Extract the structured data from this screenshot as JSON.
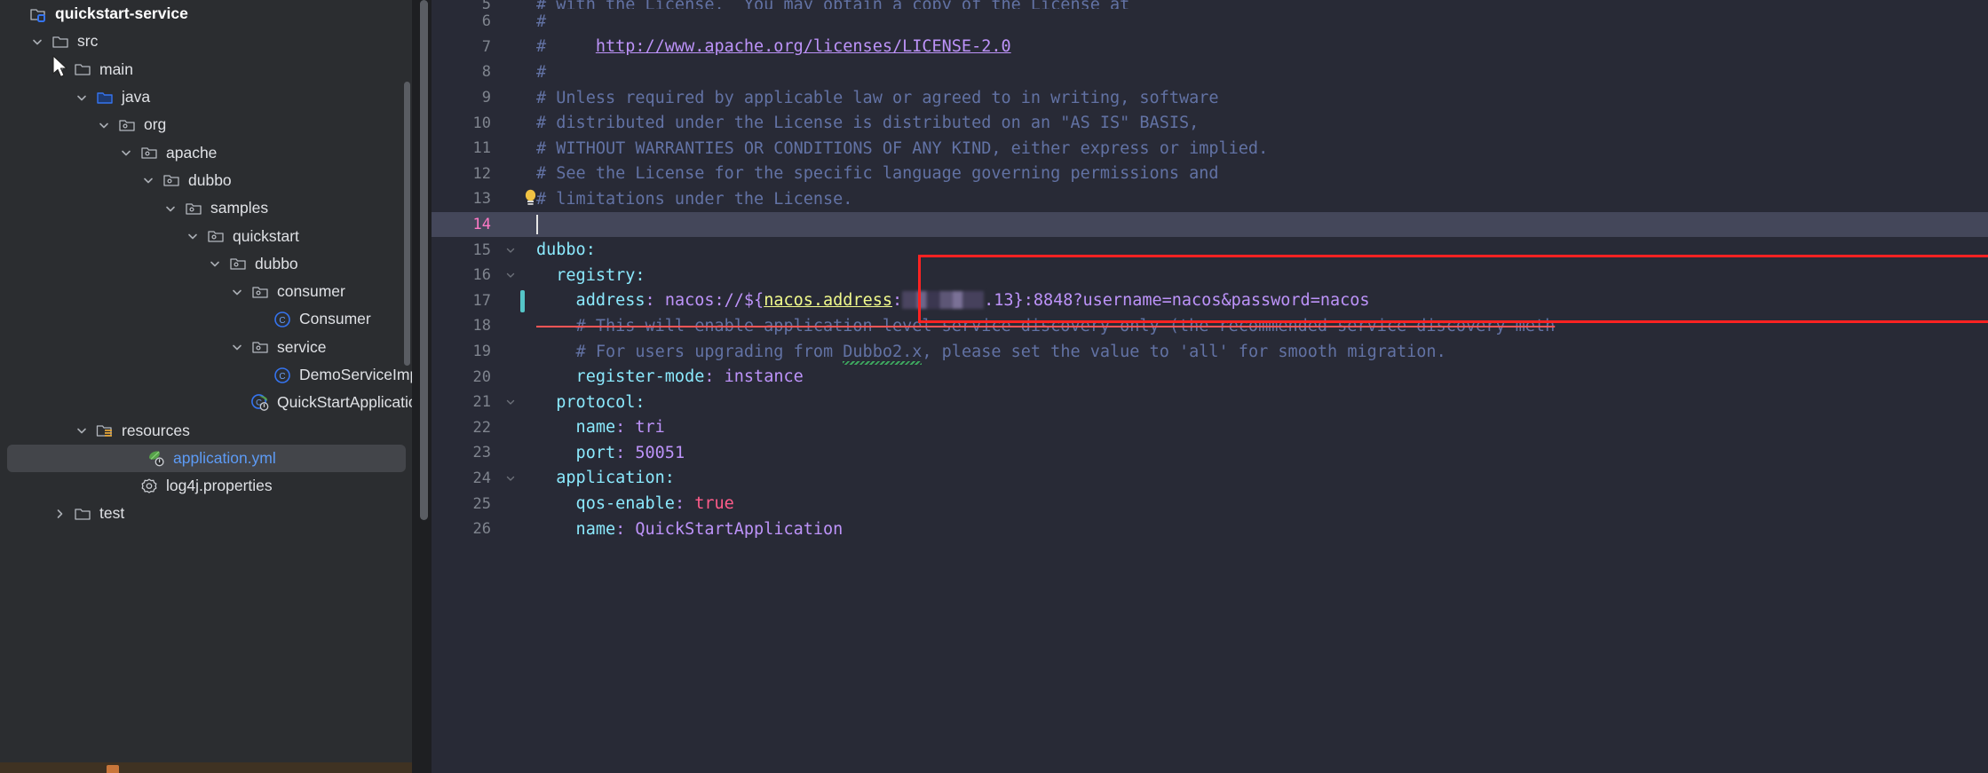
{
  "sidebar": {
    "project_name": "quickstart-service",
    "tree": [
      {
        "label": "quickstart-service",
        "depth": 0,
        "arrow": "none",
        "icon": "module-folder-icon",
        "kind": "root",
        "selected": false
      },
      {
        "label": "src",
        "depth": 1,
        "arrow": "down",
        "icon": "folder-icon",
        "kind": "folder",
        "selected": false
      },
      {
        "label": "main",
        "depth": 2,
        "arrow": "down",
        "icon": "folder-icon",
        "kind": "folder",
        "selected": false
      },
      {
        "label": "java",
        "depth": 3,
        "arrow": "down",
        "icon": "source-root-icon",
        "kind": "source",
        "selected": false
      },
      {
        "label": "org",
        "depth": 4,
        "arrow": "down",
        "icon": "package-icon",
        "kind": "package",
        "selected": false
      },
      {
        "label": "apache",
        "depth": 5,
        "arrow": "down",
        "icon": "package-icon",
        "kind": "package",
        "selected": false
      },
      {
        "label": "dubbo",
        "depth": 6,
        "arrow": "down",
        "icon": "package-icon",
        "kind": "package",
        "selected": false
      },
      {
        "label": "samples",
        "depth": 7,
        "arrow": "down",
        "icon": "package-icon",
        "kind": "package",
        "selected": false
      },
      {
        "label": "quickstart",
        "depth": 8,
        "arrow": "down",
        "icon": "package-icon",
        "kind": "package",
        "selected": false
      },
      {
        "label": "dubbo",
        "depth": 9,
        "arrow": "down",
        "icon": "package-icon",
        "kind": "package",
        "selected": false
      },
      {
        "label": "consumer",
        "depth": 10,
        "arrow": "down",
        "icon": "package-icon",
        "kind": "package",
        "selected": false
      },
      {
        "label": "Consumer",
        "depth": 11,
        "arrow": "none",
        "icon": "java-class-icon",
        "kind": "class",
        "selected": false
      },
      {
        "label": "service",
        "depth": 10,
        "arrow": "down",
        "icon": "package-icon",
        "kind": "package",
        "selected": false
      },
      {
        "label": "DemoServiceImpl",
        "depth": 11,
        "arrow": "none",
        "icon": "java-class-icon",
        "kind": "class",
        "selected": false
      },
      {
        "label": "QuickStartApplication",
        "depth": 10,
        "arrow": "none",
        "icon": "spring-boot-class-icon",
        "kind": "spring",
        "selected": false
      },
      {
        "label": "resources",
        "depth": 3,
        "arrow": "down",
        "icon": "resources-folder-icon",
        "kind": "resources",
        "selected": false
      },
      {
        "label": "application.yml",
        "depth": 5,
        "arrow": "none",
        "icon": "spring-config-icon",
        "kind": "yml",
        "selected": true
      },
      {
        "label": "log4j.properties",
        "depth": 5,
        "arrow": "none",
        "icon": "properties-file-icon",
        "kind": "properties",
        "selected": false
      },
      {
        "label": "test",
        "depth": 2,
        "arrow": "right",
        "icon": "folder-icon",
        "kind": "folder",
        "selected": false
      }
    ]
  },
  "editor": {
    "file": "application.yml",
    "current_line": 14,
    "lines": [
      {
        "num": 5,
        "partial": true,
        "fold": "",
        "tokens": [
          {
            "t": "# with the License.  You may obtain a copy of the License at",
            "c": "cmt",
            "indent": 0
          }
        ]
      },
      {
        "num": 6,
        "fold": "",
        "tokens": [
          {
            "t": "#",
            "c": "cmt"
          }
        ]
      },
      {
        "num": 7,
        "fold": "",
        "tokens": [
          {
            "t": "#     ",
            "c": "cmt"
          },
          {
            "t": "http://www.apache.org/licenses/LICENSE-2.0",
            "c": "link"
          }
        ]
      },
      {
        "num": 8,
        "fold": "",
        "tokens": [
          {
            "t": "#",
            "c": "cmt"
          }
        ]
      },
      {
        "num": 9,
        "fold": "",
        "tokens": [
          {
            "t": "# Unless required by applicable law or agreed to in writing, software",
            "c": "cmt"
          }
        ]
      },
      {
        "num": 10,
        "fold": "",
        "tokens": [
          {
            "t": "# distributed under the License is distributed on an \"AS IS\" BASIS,",
            "c": "cmt"
          }
        ]
      },
      {
        "num": 11,
        "fold": "",
        "tokens": [
          {
            "t": "# WITHOUT WARRANTIES OR CONDITIONS OF ANY KIND, either express or implied.",
            "c": "cmt"
          }
        ]
      },
      {
        "num": 12,
        "fold": "",
        "tokens": [
          {
            "t": "# See the License for the specific language governing permissions and",
            "c": "cmt"
          }
        ]
      },
      {
        "num": 13,
        "fold": "",
        "bulb": true,
        "tokens": [
          {
            "t": "# limitations under the License.",
            "c": "cmt"
          }
        ]
      },
      {
        "num": 14,
        "fold": "",
        "current": true,
        "caret": true,
        "tokens": []
      },
      {
        "num": 15,
        "fold": "v",
        "tokens": [
          {
            "t": "dubbo:",
            "c": "key"
          }
        ]
      },
      {
        "num": 16,
        "fold": "v",
        "tokens": [
          {
            "t": "  registry:",
            "c": "key"
          }
        ]
      },
      {
        "num": 17,
        "fold": "",
        "change": true,
        "tokens": [
          {
            "t": "    address",
            "c": "key"
          },
          {
            "t": ": ",
            "c": "punct"
          },
          {
            "t": "nacos://${",
            "c": "val"
          },
          {
            "t": "nacos.address",
            "c": "prop"
          },
          {
            "t": ":",
            "c": "val"
          },
          {
            "t": "REDACTED",
            "c": "redacted"
          },
          {
            "t": ".13}:8848?username=nacos&password=nacos",
            "c": "val"
          }
        ]
      },
      {
        "num": 18,
        "fold": "",
        "tokens": [
          {
            "t": "    # This will enable application level service discovery only (the recommended service discovery meth",
            "c": "cmt strike"
          }
        ]
      },
      {
        "num": 19,
        "fold": "",
        "tokens": [
          {
            "t": "    # For users upgrading from ",
            "c": "cmt"
          },
          {
            "t": "Dubbo2.x",
            "c": "cmt spell"
          },
          {
            "t": ", please set the value to 'all' for smooth migration.",
            "c": "cmt"
          }
        ]
      },
      {
        "num": 20,
        "fold": "",
        "tokens": [
          {
            "t": "    register-mode",
            "c": "key"
          },
          {
            "t": ": ",
            "c": "punct"
          },
          {
            "t": "instance",
            "c": "val"
          }
        ]
      },
      {
        "num": 21,
        "fold": "v",
        "tokens": [
          {
            "t": "  protocol:",
            "c": "key"
          }
        ]
      },
      {
        "num": 22,
        "fold": "",
        "tokens": [
          {
            "t": "    name",
            "c": "key"
          },
          {
            "t": ": ",
            "c": "punct"
          },
          {
            "t": "tri",
            "c": "val"
          }
        ]
      },
      {
        "num": 23,
        "fold": "",
        "tokens": [
          {
            "t": "    port",
            "c": "key"
          },
          {
            "t": ": ",
            "c": "punct"
          },
          {
            "t": "50051",
            "c": "num"
          }
        ]
      },
      {
        "num": 24,
        "fold": "v",
        "tokens": [
          {
            "t": "  application:",
            "c": "key"
          }
        ]
      },
      {
        "num": 25,
        "fold": "",
        "tokens": [
          {
            "t": "    qos-enable",
            "c": "key"
          },
          {
            "t": ": ",
            "c": "punct"
          },
          {
            "t": "true",
            "c": "bool"
          }
        ]
      },
      {
        "num": 26,
        "fold": "",
        "tokens": [
          {
            "t": "    name",
            "c": "key"
          },
          {
            "t": ": ",
            "c": "punct"
          },
          {
            "t": "QuickStartApplication",
            "c": "val"
          }
        ]
      }
    ]
  },
  "annotation": {
    "highlight_box_color": "#ff2222",
    "highlight_lines": [
      16,
      17,
      18
    ]
  },
  "colors": {
    "sidebar_bg": "#2b2d30",
    "editor_bg": "#282a36",
    "selection_bg": "#43454a",
    "current_line_bg": "#44475a",
    "accent_blue": "#5d9bf5",
    "comment": "#6272a4",
    "key": "#8be9fd",
    "value": "#bd93f9",
    "bool": "#ff5c8a"
  }
}
